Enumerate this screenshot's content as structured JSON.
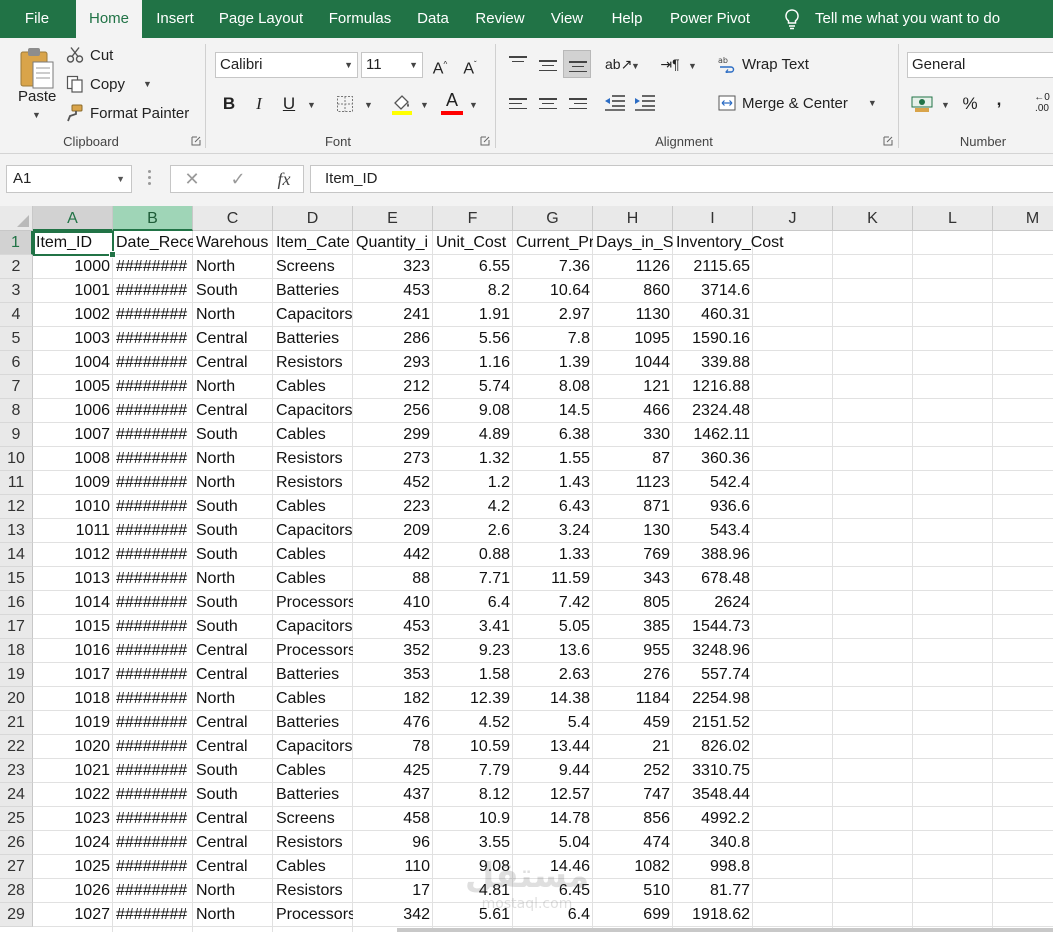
{
  "ribbon_tabs": [
    "File",
    "Home",
    "Insert",
    "Page Layout",
    "Formulas",
    "Data",
    "Review",
    "View",
    "Help",
    "Power Pivot"
  ],
  "active_tab": "Home",
  "tell_me": "Tell me what you want to do",
  "clipboard": {
    "paste": "Paste",
    "cut": "Cut",
    "copy": "Copy",
    "format_painter": "Format Painter",
    "label": "Clipboard"
  },
  "font": {
    "name": "Calibri",
    "size": "11",
    "bold": "B",
    "italic": "I",
    "underline": "U",
    "label": "Font"
  },
  "alignment": {
    "wrap_text": "Wrap Text",
    "merge_center": "Merge & Center",
    "label": "Alignment"
  },
  "number": {
    "format": "General",
    "percent": "%",
    "comma": ",",
    "label": "Number"
  },
  "formula_bar": {
    "name_box": "A1",
    "fx": "fx",
    "value": "Item_ID"
  },
  "colors": {
    "excel_green": "#217346",
    "selected_header": "#9fd5b7"
  },
  "columns": [
    "A",
    "B",
    "C",
    "D",
    "E",
    "F",
    "G",
    "H",
    "I",
    "J",
    "K",
    "L",
    "M"
  ],
  "header_row": [
    "Item_ID",
    "Date_Rece",
    "Warehous",
    "Item_Cate",
    "Quantity_i",
    "Unit_Cost",
    "Current_Pr",
    "Days_in_St",
    "Inventory_Cost"
  ],
  "rows": [
    [
      "1000",
      "########",
      "North",
      "Screens",
      "323",
      "6.55",
      "7.36",
      "1126",
      "2115.65"
    ],
    [
      "1001",
      "########",
      "South",
      "Batteries",
      "453",
      "8.2",
      "10.64",
      "860",
      "3714.6"
    ],
    [
      "1002",
      "########",
      "North",
      "Capacitors",
      "241",
      "1.91",
      "2.97",
      "1130",
      "460.31"
    ],
    [
      "1003",
      "########",
      "Central",
      "Batteries",
      "286",
      "5.56",
      "7.8",
      "1095",
      "1590.16"
    ],
    [
      "1004",
      "########",
      "Central",
      "Resistors",
      "293",
      "1.16",
      "1.39",
      "1044",
      "339.88"
    ],
    [
      "1005",
      "########",
      "North",
      "Cables",
      "212",
      "5.74",
      "8.08",
      "121",
      "1216.88"
    ],
    [
      "1006",
      "########",
      "Central",
      "Capacitors",
      "256",
      "9.08",
      "14.5",
      "466",
      "2324.48"
    ],
    [
      "1007",
      "########",
      "South",
      "Cables",
      "299",
      "4.89",
      "6.38",
      "330",
      "1462.11"
    ],
    [
      "1008",
      "########",
      "North",
      "Resistors",
      "273",
      "1.32",
      "1.55",
      "87",
      "360.36"
    ],
    [
      "1009",
      "########",
      "North",
      "Resistors",
      "452",
      "1.2",
      "1.43",
      "1123",
      "542.4"
    ],
    [
      "1010",
      "########",
      "South",
      "Cables",
      "223",
      "4.2",
      "6.43",
      "871",
      "936.6"
    ],
    [
      "1011",
      "########",
      "South",
      "Capacitors",
      "209",
      "2.6",
      "3.24",
      "130",
      "543.4"
    ],
    [
      "1012",
      "########",
      "South",
      "Cables",
      "442",
      "0.88",
      "1.33",
      "769",
      "388.96"
    ],
    [
      "1013",
      "########",
      "North",
      "Cables",
      "88",
      "7.71",
      "11.59",
      "343",
      "678.48"
    ],
    [
      "1014",
      "########",
      "South",
      "Processors",
      "410",
      "6.4",
      "7.42",
      "805",
      "2624"
    ],
    [
      "1015",
      "########",
      "South",
      "Capacitors",
      "453",
      "3.41",
      "5.05",
      "385",
      "1544.73"
    ],
    [
      "1016",
      "########",
      "Central",
      "Processors",
      "352",
      "9.23",
      "13.6",
      "955",
      "3248.96"
    ],
    [
      "1017",
      "########",
      "Central",
      "Batteries",
      "353",
      "1.58",
      "2.63",
      "276",
      "557.74"
    ],
    [
      "1018",
      "########",
      "North",
      "Cables",
      "182",
      "12.39",
      "14.38",
      "1184",
      "2254.98"
    ],
    [
      "1019",
      "########",
      "Central",
      "Batteries",
      "476",
      "4.52",
      "5.4",
      "459",
      "2151.52"
    ],
    [
      "1020",
      "########",
      "Central",
      "Capacitors",
      "78",
      "10.59",
      "13.44",
      "21",
      "826.02"
    ],
    [
      "1021",
      "########",
      "South",
      "Cables",
      "425",
      "7.79",
      "9.44",
      "252",
      "3310.75"
    ],
    [
      "1022",
      "########",
      "South",
      "Batteries",
      "437",
      "8.12",
      "12.57",
      "747",
      "3548.44"
    ],
    [
      "1023",
      "########",
      "Central",
      "Screens",
      "458",
      "10.9",
      "14.78",
      "856",
      "4992.2"
    ],
    [
      "1024",
      "########",
      "Central",
      "Resistors",
      "96",
      "3.55",
      "5.04",
      "474",
      "340.8"
    ],
    [
      "1025",
      "########",
      "Central",
      "Cables",
      "110",
      "9.08",
      "14.46",
      "1082",
      "998.8"
    ],
    [
      "1026",
      "########",
      "North",
      "Resistors",
      "17",
      "4.81",
      "6.45",
      "510",
      "81.77"
    ],
    [
      "1027",
      "########",
      "North",
      "Processors",
      "342",
      "5.61",
      "6.4",
      "699",
      "1918.62"
    ]
  ],
  "watermark": {
    "arabic": "مستقل",
    "latin": "mostaql.com"
  }
}
